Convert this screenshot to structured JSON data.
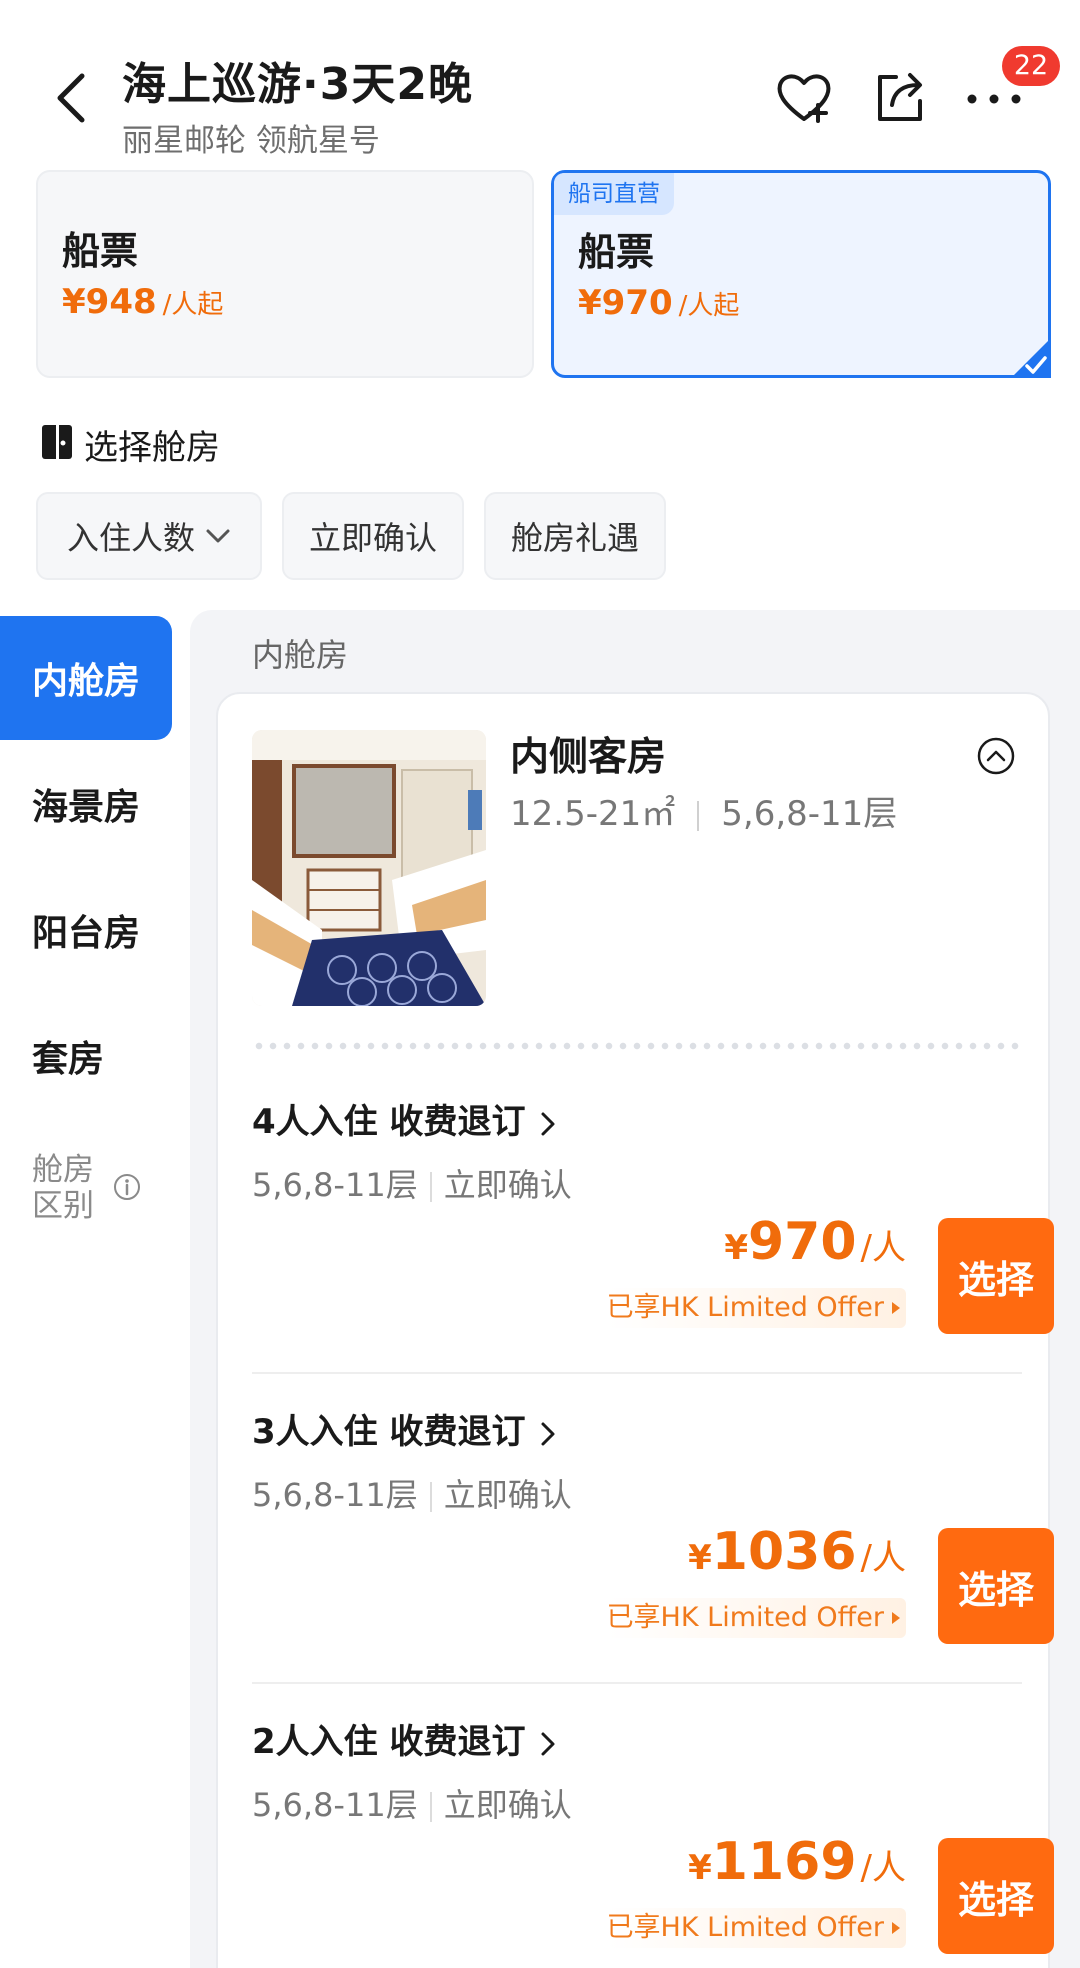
{
  "header": {
    "title": "海上巡游·3天2晚",
    "subtitle": "丽星邮轮 领航星号",
    "badge_count": "22",
    "icons": [
      "back-arrow-icon",
      "heart-plus-icon",
      "share-icon",
      "more-icon"
    ]
  },
  "tickets": [
    {
      "name": "船票",
      "price": "¥948",
      "unit": "/人起",
      "ribbon": "",
      "selected": false
    },
    {
      "name": "船票",
      "price": "¥970",
      "unit": "/人起",
      "ribbon": "船司直营",
      "selected": true
    }
  ],
  "section": {
    "label": "选择舱房"
  },
  "filters": [
    "入住人数",
    "立即确认",
    "舱房礼遇"
  ],
  "nav": {
    "items": [
      "内舱房",
      "海景房",
      "阳台房",
      "套房"
    ],
    "active": "内舱房",
    "diff_line1": "舱房",
    "diff_line2": "区别"
  },
  "panel": {
    "title": "内舱房",
    "room": {
      "name": "内侧客房",
      "area": "12.5-21㎡",
      "floors": "5,6,8-11层"
    },
    "offers": [
      {
        "title": "4人入住  收费退订",
        "floors": "5,6,8-11层",
        "confirm": "立即确认",
        "yen": "¥",
        "price": "970",
        "unit": "/人",
        "promo": "已享HK Limited Offer",
        "button": "选择"
      },
      {
        "title": "3人入住  收费退订",
        "floors": "5,6,8-11层",
        "confirm": "立即确认",
        "yen": "¥",
        "price": "1036",
        "unit": "/人",
        "promo": "已享HK Limited Offer",
        "button": "选择"
      },
      {
        "title": "2人入住  收费退订",
        "floors": "5,6,8-11层",
        "confirm": "立即确认",
        "yen": "¥",
        "price": "1169",
        "unit": "/人",
        "promo": "已享HK Limited Offer",
        "button": "选择"
      }
    ]
  },
  "colors": {
    "accent_blue": "#1f74f0",
    "price_orange": "#f06c0b",
    "button_orange": "#ff6a10",
    "badge_red": "#f03a2f"
  }
}
